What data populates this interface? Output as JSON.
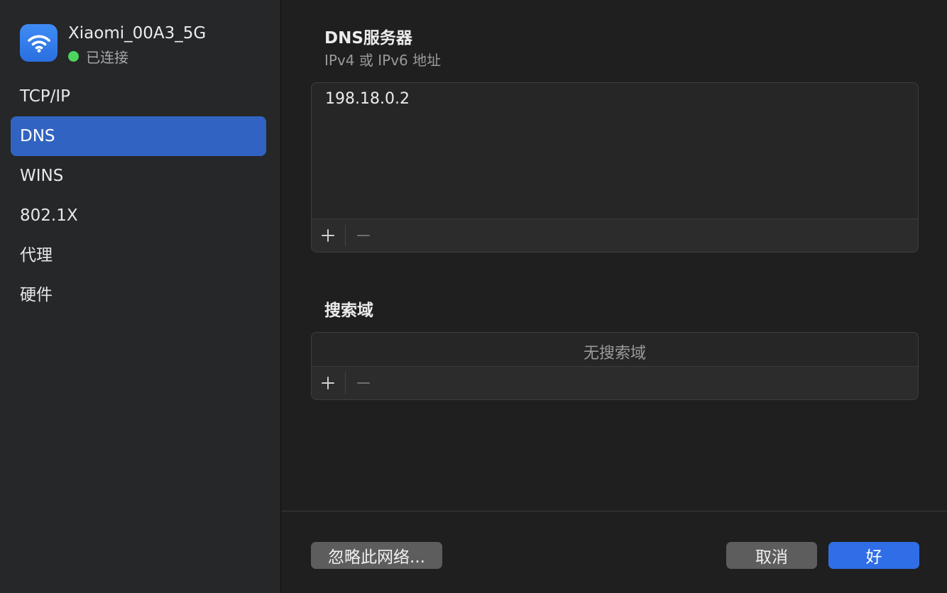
{
  "network": {
    "name": "Xiaomi_00A3_5G",
    "status": "已连接",
    "icon": "wifi-icon",
    "status_color": "#4cd45f"
  },
  "sidebar": {
    "items": [
      {
        "label": "TCP/IP",
        "selected": false
      },
      {
        "label": "DNS",
        "selected": true
      },
      {
        "label": "WINS",
        "selected": false
      },
      {
        "label": "802.1X",
        "selected": false
      },
      {
        "label": "代理",
        "selected": false
      },
      {
        "label": "硬件",
        "selected": false
      }
    ]
  },
  "dns": {
    "title": "DNS服务器",
    "subtitle": "IPv4 或 IPv6 地址",
    "servers": [
      "198.18.0.2"
    ],
    "add_icon": "plus-icon",
    "remove_icon": "minus-icon"
  },
  "search_domains": {
    "title": "搜索域",
    "empty_text": "无搜索域",
    "add_icon": "plus-icon",
    "remove_icon": "minus-icon"
  },
  "footer": {
    "ignore_label": "忽略此网络...",
    "cancel_label": "取消",
    "ok_label": "好"
  },
  "colors": {
    "accent": "#2f6ee6",
    "sidebar_selected": "#3164c2"
  }
}
